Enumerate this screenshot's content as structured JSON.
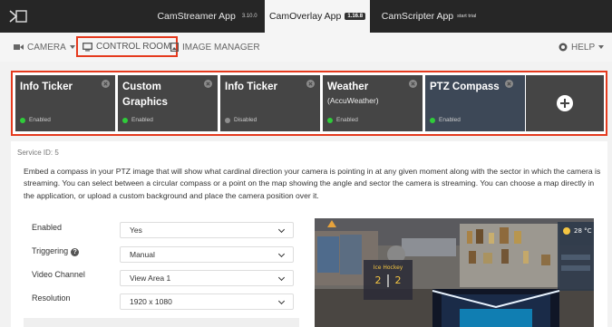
{
  "apps": {
    "streamer": {
      "label": "CamStreamer App",
      "version": "3.10.0"
    },
    "overlay": {
      "label": "CamOverlay App",
      "version": "1.16.8"
    },
    "scripter": {
      "label": "CamScripter App",
      "trial": "start trial"
    }
  },
  "nav": {
    "camera": "CAMERA",
    "control_room": "CONTROL ROOM",
    "image_manager": "IMAGE MANAGER",
    "help": "HELP"
  },
  "widgets": [
    {
      "title": "Info Ticker",
      "subtitle": "",
      "status": "Enabled",
      "enabled": true
    },
    {
      "title": "Custom Graphics",
      "subtitle": "",
      "status": "Enabled",
      "enabled": true
    },
    {
      "title": "Info Ticker",
      "subtitle": "",
      "status": "Disabled",
      "enabled": false
    },
    {
      "title": "Weather",
      "subtitle": "(AccuWeather)",
      "status": "Enabled",
      "enabled": true
    },
    {
      "title": "PTZ Compass",
      "subtitle": "",
      "status": "Enabled",
      "enabled": true
    }
  ],
  "service_id": "Service ID: 5",
  "description": "Embed a compass in your PTZ image that will show what cardinal direction your camera is pointing in at any given moment along with the sector in which the camera is streaming. You can select between a circular compass or a point on the map showing the angle and sector the camera is streaming. You can choose a map directly in the application, or upload a custom background and place the camera position over it.",
  "form": {
    "enabled": {
      "label": "Enabled",
      "value": "Yes"
    },
    "triggering": {
      "label": "Triggering",
      "value": "Manual"
    },
    "video_channel": {
      "label": "Video Channel",
      "value": "View Area 1"
    },
    "resolution": {
      "label": "Resolution",
      "value": "1920 x 1080"
    }
  },
  "preview": {
    "score_title": "Ice Hockey",
    "score_home": "2",
    "score_away": "2",
    "weather_temp": "28 °C"
  },
  "colors": {
    "topbar": "#262626",
    "highlight": "#e53a1e",
    "card": "#454545",
    "card_active": "#3d4857",
    "enabled_dot": "#2fcc3a"
  }
}
